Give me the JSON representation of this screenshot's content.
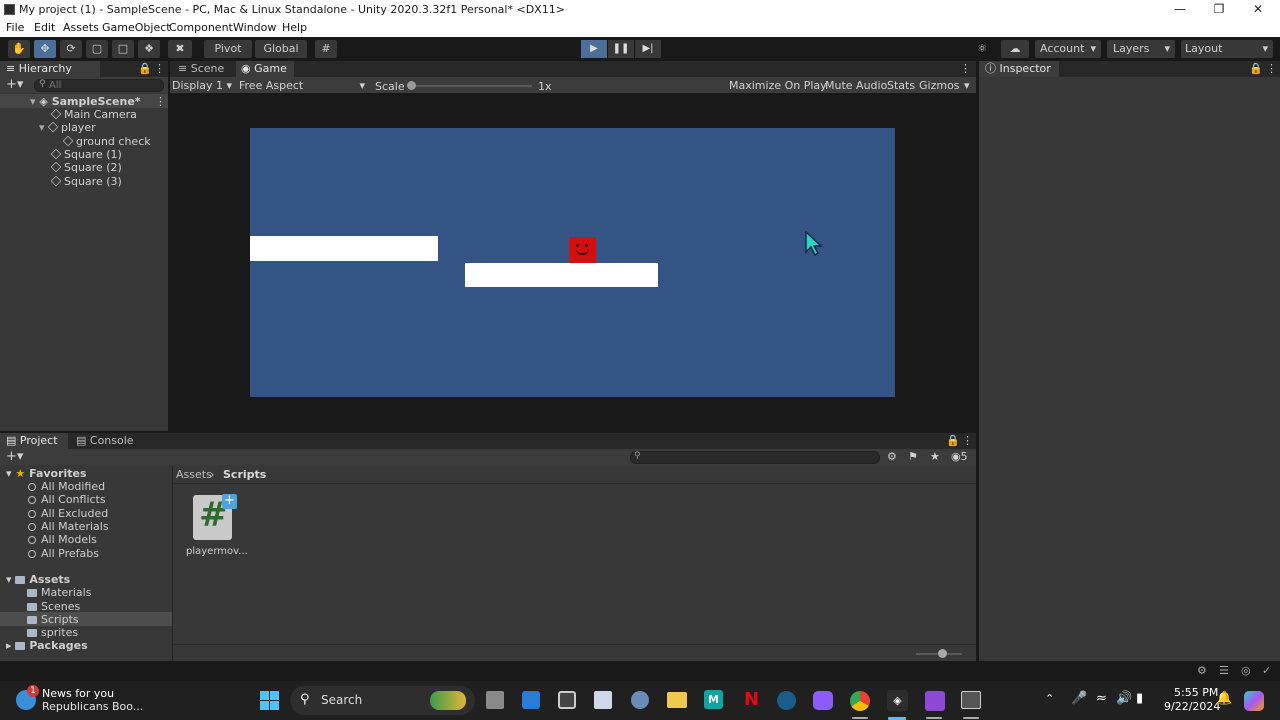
{
  "window": {
    "title": "My project (1) - SampleScene - PC, Mac & Linux Standalone - Unity 2020.3.32f1 Personal* <DX11>",
    "minimize_icon": "minimize-icon",
    "maximize_icon": "maximize-icon",
    "close_icon": "close-icon"
  },
  "menu": [
    "File",
    "Edit",
    "Assets",
    "GameObject",
    "Component",
    "Window",
    "Help"
  ],
  "toolbar": {
    "pivot_label": "Pivot",
    "global_label": "Global",
    "account_label": "Account",
    "layers_label": "Layers",
    "layout_label": "Layout",
    "playing": true
  },
  "hierarchy": {
    "tab": "Hierarchy",
    "search_placeholder": "All",
    "items": [
      {
        "label": "SampleScene*",
        "depth": 0
      },
      {
        "label": "Main Camera",
        "depth": 1
      },
      {
        "label": "player",
        "depth": 1
      },
      {
        "label": "ground check",
        "depth": 2
      },
      {
        "label": "Square (1)",
        "depth": 1
      },
      {
        "label": "Square (2)",
        "depth": 1
      },
      {
        "label": "Square (3)",
        "depth": 1
      }
    ]
  },
  "game": {
    "tabs": [
      "Scene",
      "Game"
    ],
    "active_tab": "Game",
    "display": "Display 1",
    "aspect": "Free Aspect",
    "scale_label": "Scale",
    "scale_value": "1x",
    "buttons": [
      "Maximize On Play",
      "Mute Audio",
      "Stats",
      "Gizmos"
    ],
    "background_color": "#345485",
    "player_color": "#d40f0f"
  },
  "inspector": {
    "tab": "Inspector"
  },
  "project": {
    "tabs": [
      "Project",
      "Console"
    ],
    "favorites_label": "Favorites",
    "favorites": [
      "All Modified",
      "All Conflicts",
      "All Excluded",
      "All Materials",
      "All Models",
      "All Prefabs"
    ],
    "assets_label": "Assets",
    "asset_folders": [
      "Materials",
      "Scenes",
      "Scripts",
      "sprites"
    ],
    "selected_folder": "Scripts",
    "packages_label": "Packages",
    "breadcrumb": [
      "Assets",
      "Scripts"
    ],
    "hidden_count": "5",
    "files": [
      {
        "name": "playermov...",
        "icon": "csharp-script-icon"
      }
    ]
  },
  "taskbar": {
    "news_title": "News for you",
    "news_sub": "Republicans Boo...",
    "news_badge": "1",
    "search_label": "Search",
    "time": "5:55 PM",
    "date": "9/22/2024"
  }
}
